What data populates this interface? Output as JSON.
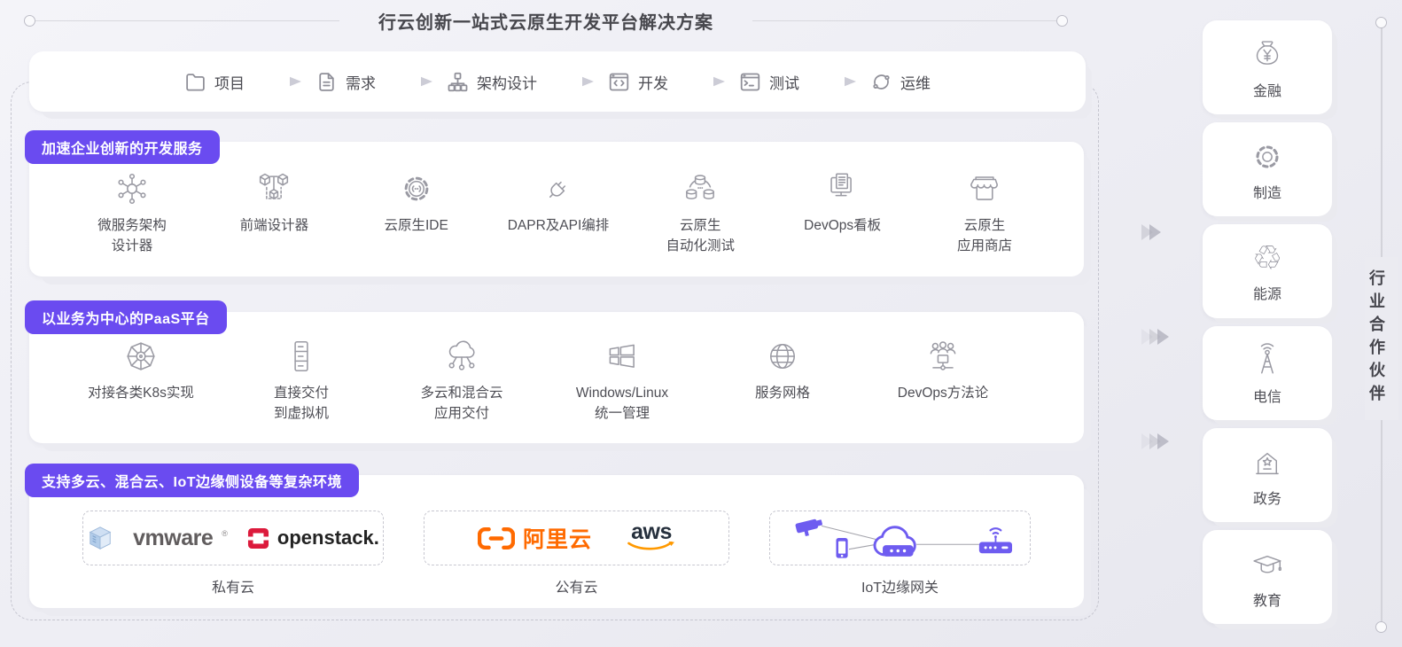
{
  "header": {
    "title": "行云创新一站式云原生开发平台解决方案"
  },
  "workflow": {
    "steps": [
      {
        "label": "项目"
      },
      {
        "label": "需求"
      },
      {
        "label": "架构设计"
      },
      {
        "label": "开发"
      },
      {
        "label": "测试"
      },
      {
        "label": "运维"
      }
    ]
  },
  "sections": [
    {
      "badge": "加速企业创新的开发服务",
      "items": [
        {
          "label": "微服务架构\n设计器"
        },
        {
          "label": "前端设计器"
        },
        {
          "label": "云原生IDE"
        },
        {
          "label": "DAPR及API编排"
        },
        {
          "label": "云原生\n自动化测试"
        },
        {
          "label": "DevOps看板"
        },
        {
          "label": "云原生\n应用商店"
        }
      ]
    },
    {
      "badge": "以业务为中心的PaaS平台",
      "items": [
        {
          "label": "对接各类K8s实现"
        },
        {
          "label": "直接交付\n到虚拟机"
        },
        {
          "label": "多云和混合云\n应用交付"
        },
        {
          "label": "Windows/Linux\n统一管理"
        },
        {
          "label": "服务网格"
        },
        {
          "label": "DevOps方法论"
        }
      ]
    },
    {
      "badge": "支持多云、混合云、IoT边缘侧设备等复杂环境",
      "environments": [
        {
          "label": "私有云"
        },
        {
          "label": "公有云"
        },
        {
          "label": "IoT边缘网关"
        }
      ]
    }
  ],
  "logos": {
    "vmware": "vmware",
    "vmware_reg": "®",
    "openstack": "openstack.",
    "alicloud": "阿里云",
    "aws": "aws"
  },
  "sidebar": {
    "label": "行业合作伙伴",
    "industries": [
      {
        "label": "金融"
      },
      {
        "label": "制造"
      },
      {
        "label": "能源"
      },
      {
        "label": "电信"
      },
      {
        "label": "政务"
      },
      {
        "label": "教育"
      }
    ]
  },
  "icons": {
    "recycle": "♲"
  },
  "colors": {
    "accent_purple": "#6A4BF0",
    "iot_purple": "#6E5CF0",
    "alicloud_orange": "#FF6A00",
    "aws_navy": "#26303D",
    "aws_orange": "#FF9900",
    "openstack_red": "#DC1A3C",
    "vmware_gray": "#615D5E"
  }
}
